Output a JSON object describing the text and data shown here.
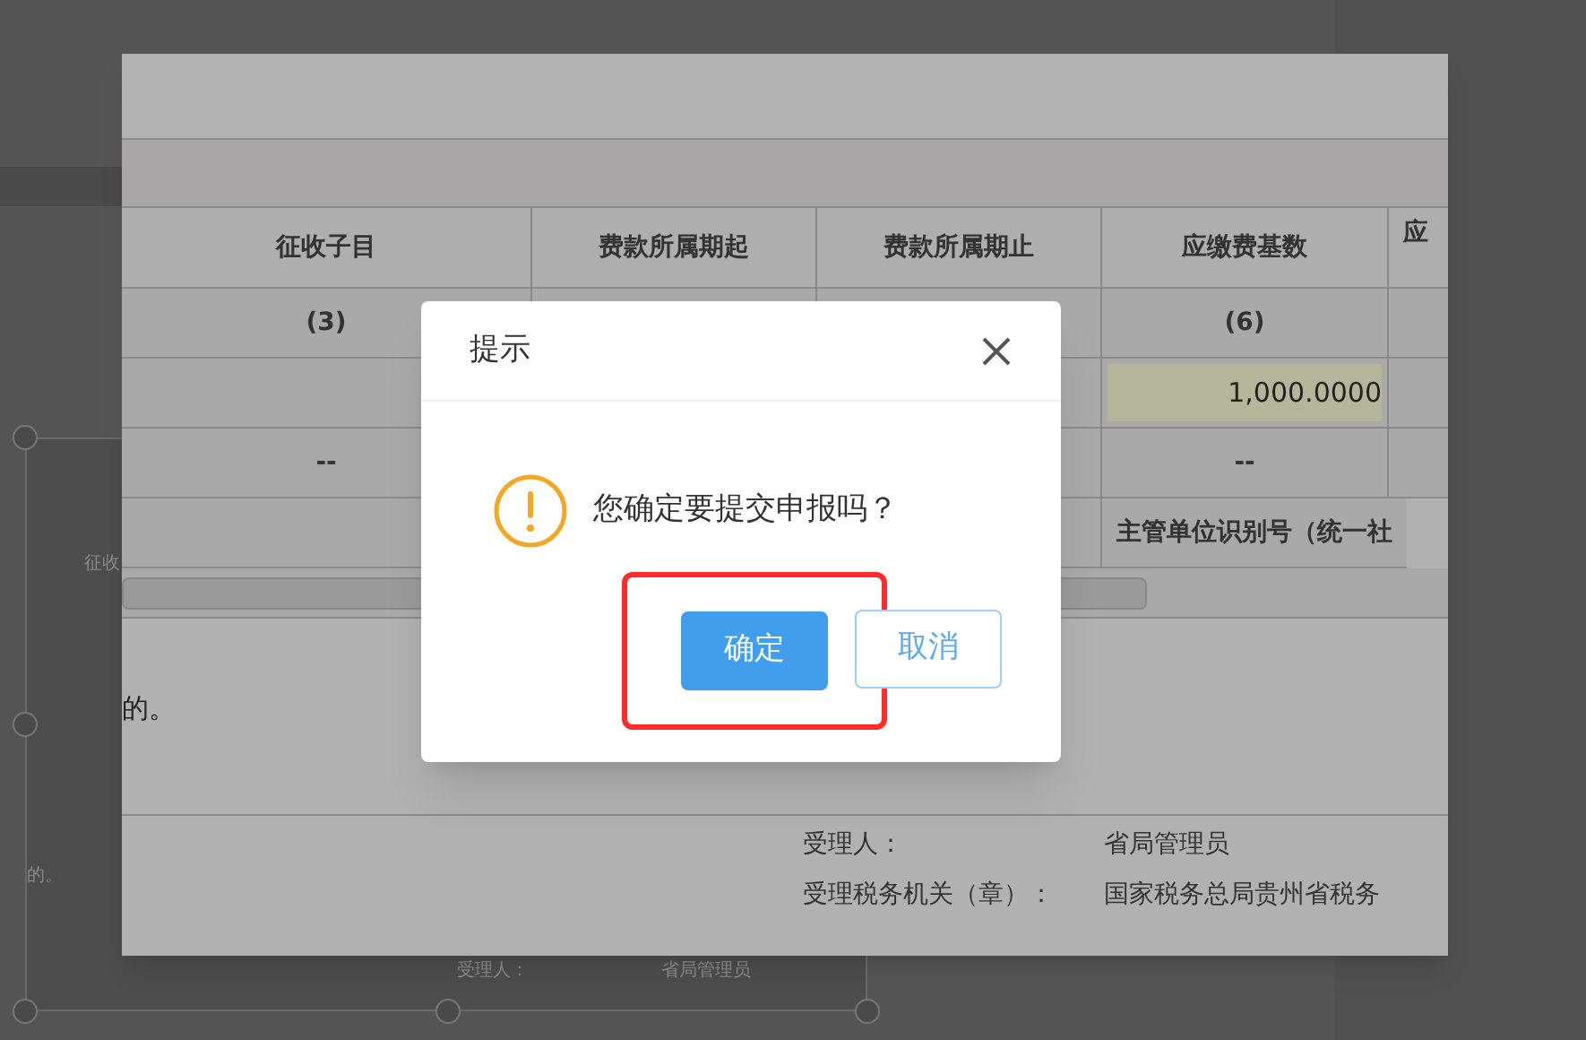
{
  "background_capture": {
    "texts": [
      "征收",
      "的。",
      "受理人：",
      "省局管理员"
    ]
  },
  "page": {
    "table": {
      "columns": [
        "征收子目",
        "费款所属期起",
        "费款所属期止",
        "应缴费基数",
        "应"
      ],
      "rows": [
        {
          "column_1": {
            "kind": "text",
            "text": "(3)"
          },
          "column_4": {
            "kind": "text",
            "text": "(6)"
          }
        },
        {
          "column_4": {
            "kind": "input",
            "text": "1,000.0000"
          }
        },
        {
          "column_1": {
            "kind": "text",
            "text": "--"
          },
          "column_4": {
            "kind": "text",
            "text": "--"
          }
        },
        {
          "column_4": {
            "kind": "span",
            "text": "主管单位识别号（统一社"
          }
        }
      ]
    },
    "note": "的。",
    "signature": [
      {
        "label": "受理人：",
        "value": "省局管理员"
      },
      {
        "label": "受理税务机关（章）：",
        "value": "国家税务总局贵州省税务"
      }
    ]
  },
  "dialog": {
    "title": "提示",
    "message": "您确定要提交申报吗？",
    "buttons": [
      {
        "label": "确定",
        "kind": "primary",
        "highlighted": true
      },
      {
        "label": "取消",
        "kind": "secondary",
        "highlighted": false
      }
    ]
  }
}
